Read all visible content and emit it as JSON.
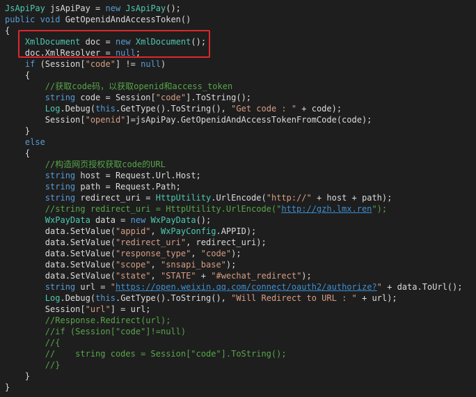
{
  "colors": {
    "background": "#1e1e1e",
    "keyword": "#569cd6",
    "type": "#4ec9b0",
    "string": "#d69d85",
    "comment": "#57a64a",
    "plain": "#dcdcdc",
    "link": "#3d8fd1",
    "highlight_box": "#e0262c"
  },
  "lines": [
    {
      "indent": "",
      "tokens": [
        [
          "type",
          "JsApiPay"
        ],
        [
          "plain",
          " jsApiPay = "
        ],
        [
          "keyword",
          "new"
        ],
        [
          "plain",
          " "
        ],
        [
          "type",
          "JsApiPay"
        ],
        [
          "plain",
          "();"
        ]
      ]
    },
    {
      "indent": "",
      "tokens": [
        [
          "keyword",
          "public"
        ],
        [
          "plain",
          " "
        ],
        [
          "keyword",
          "void"
        ],
        [
          "plain",
          " GetOpenidAndAccessToken()"
        ]
      ]
    },
    {
      "indent": "",
      "tokens": [
        [
          "plain",
          "{"
        ]
      ]
    },
    {
      "indent": "    ",
      "tokens": [
        [
          "type",
          "XmlDocument"
        ],
        [
          "plain",
          " doc = "
        ],
        [
          "keyword",
          "new"
        ],
        [
          "plain",
          " "
        ],
        [
          "type",
          "XmlDocument"
        ],
        [
          "plain",
          "();"
        ]
      ]
    },
    {
      "indent": "    ",
      "tokens": [
        [
          "plain",
          "doc.XmlResolver = "
        ],
        [
          "keyword",
          "null"
        ],
        [
          "plain",
          ";"
        ]
      ]
    },
    {
      "indent": "    ",
      "tokens": [
        [
          "keyword",
          "if"
        ],
        [
          "plain",
          " (Session["
        ],
        [
          "string",
          "\"code\""
        ],
        [
          "plain",
          "] != "
        ],
        [
          "keyword",
          "null"
        ],
        [
          "plain",
          ")"
        ]
      ]
    },
    {
      "indent": "    ",
      "tokens": [
        [
          "plain",
          "{"
        ]
      ]
    },
    {
      "indent": "        ",
      "tokens": [
        [
          "comment",
          "//获取code码，以获取openid和access_token"
        ]
      ]
    },
    {
      "indent": "        ",
      "tokens": [
        [
          "keyword",
          "string"
        ],
        [
          "plain",
          " code = Session["
        ],
        [
          "string",
          "\"code\""
        ],
        [
          "plain",
          "].ToString();"
        ]
      ]
    },
    {
      "indent": "        ",
      "tokens": [
        [
          "type",
          "Log"
        ],
        [
          "plain",
          ".Debug("
        ],
        [
          "keyword",
          "this"
        ],
        [
          "plain",
          ".GetType().ToString(), "
        ],
        [
          "string",
          "\"Get code : \""
        ],
        [
          "plain",
          " + code);"
        ]
      ]
    },
    {
      "indent": "        ",
      "tokens": [
        [
          "plain",
          "Session["
        ],
        [
          "string",
          "\"openid\""
        ],
        [
          "plain",
          "]=jsApiPay.GetOpenidAndAccessTokenFromCode(code);"
        ]
      ]
    },
    {
      "indent": "    ",
      "tokens": [
        [
          "plain",
          "}"
        ]
      ]
    },
    {
      "indent": "    ",
      "tokens": [
        [
          "keyword",
          "else"
        ]
      ]
    },
    {
      "indent": "    ",
      "tokens": [
        [
          "plain",
          "{"
        ]
      ]
    },
    {
      "indent": "        ",
      "tokens": [
        [
          "comment",
          "//构造网页授权获取code的URL"
        ]
      ]
    },
    {
      "indent": "        ",
      "tokens": [
        [
          "keyword",
          "string"
        ],
        [
          "plain",
          " host = Request.Url.Host;"
        ]
      ]
    },
    {
      "indent": "        ",
      "tokens": [
        [
          "keyword",
          "string"
        ],
        [
          "plain",
          " path = Request.Path;"
        ]
      ]
    },
    {
      "indent": "        ",
      "tokens": [
        [
          "keyword",
          "string"
        ],
        [
          "plain",
          " redirect_uri = "
        ],
        [
          "type",
          "HttpUtility"
        ],
        [
          "plain",
          ".UrlEncode("
        ],
        [
          "string",
          "\"http://\""
        ],
        [
          "plain",
          " + host + path);"
        ]
      ]
    },
    {
      "indent": "        ",
      "tokens": [
        [
          "comment",
          "//string redirect_uri = HttpUtility.UrlEncode(\""
        ],
        [
          "link",
          "http://gzh.lmx.ren"
        ],
        [
          "comment",
          "\");"
        ]
      ]
    },
    {
      "indent": "        ",
      "tokens": [
        [
          "type",
          "WxPayData"
        ],
        [
          "plain",
          " data = "
        ],
        [
          "keyword",
          "new"
        ],
        [
          "plain",
          " "
        ],
        [
          "type",
          "WxPayData"
        ],
        [
          "plain",
          "();"
        ]
      ]
    },
    {
      "indent": "        ",
      "tokens": [
        [
          "plain",
          "data.SetValue("
        ],
        [
          "string",
          "\"appid\""
        ],
        [
          "plain",
          ", "
        ],
        [
          "type",
          "WxPayConfig"
        ],
        [
          "plain",
          ".APPID);"
        ]
      ]
    },
    {
      "indent": "        ",
      "tokens": [
        [
          "plain",
          "data.SetValue("
        ],
        [
          "string",
          "\"redirect_uri\""
        ],
        [
          "plain",
          ", redirect_uri);"
        ]
      ]
    },
    {
      "indent": "        ",
      "tokens": [
        [
          "plain",
          "data.SetValue("
        ],
        [
          "string",
          "\"response_type\""
        ],
        [
          "plain",
          ", "
        ],
        [
          "string",
          "\"code\""
        ],
        [
          "plain",
          ");"
        ]
      ]
    },
    {
      "indent": "        ",
      "tokens": [
        [
          "plain",
          "data.SetValue("
        ],
        [
          "string",
          "\"scope\""
        ],
        [
          "plain",
          ", "
        ],
        [
          "string",
          "\"snsapi_base\""
        ],
        [
          "plain",
          ");"
        ]
      ]
    },
    {
      "indent": "        ",
      "tokens": [
        [
          "plain",
          "data.SetValue("
        ],
        [
          "string",
          "\"state\""
        ],
        [
          "plain",
          ", "
        ],
        [
          "string",
          "\"STATE\""
        ],
        [
          "plain",
          " + "
        ],
        [
          "string",
          "\"#wechat_redirect\""
        ],
        [
          "plain",
          ");"
        ]
      ]
    },
    {
      "indent": "        ",
      "tokens": [
        [
          "keyword",
          "string"
        ],
        [
          "plain",
          " url = "
        ],
        [
          "string",
          "\""
        ],
        [
          "link",
          "https://open.weixin.qq.com/connect/oauth2/authorize?"
        ],
        [
          "string",
          "\""
        ],
        [
          "plain",
          " + data.ToUrl();"
        ]
      ]
    },
    {
      "indent": "        ",
      "tokens": [
        [
          "type",
          "Log"
        ],
        [
          "plain",
          ".Debug("
        ],
        [
          "keyword",
          "this"
        ],
        [
          "plain",
          ".GetType().ToString(), "
        ],
        [
          "string",
          "\"Will Redirect to URL : \""
        ],
        [
          "plain",
          " + url);"
        ]
      ]
    },
    {
      "indent": "        ",
      "tokens": [
        [
          "plain",
          "Session["
        ],
        [
          "string",
          "\"url\""
        ],
        [
          "plain",
          "] = url;"
        ]
      ]
    },
    {
      "indent": "        ",
      "tokens": [
        [
          "comment",
          "//Response.Redirect(url);"
        ]
      ]
    },
    {
      "indent": "        ",
      "tokens": [
        [
          "comment",
          "//if (Session[\"code\"]!=null)"
        ]
      ]
    },
    {
      "indent": "        ",
      "tokens": [
        [
          "comment",
          "//{"
        ]
      ]
    },
    {
      "indent": "        ",
      "tokens": [
        [
          "comment",
          "//    string codes = Session[\"code\"].ToString();"
        ]
      ]
    },
    {
      "indent": "        ",
      "tokens": [
        [
          "comment",
          "//}"
        ]
      ]
    },
    {
      "indent": "    ",
      "tokens": [
        [
          "plain",
          "}"
        ]
      ]
    },
    {
      "indent": "",
      "tokens": [
        [
          "plain",
          "}"
        ]
      ]
    }
  ]
}
